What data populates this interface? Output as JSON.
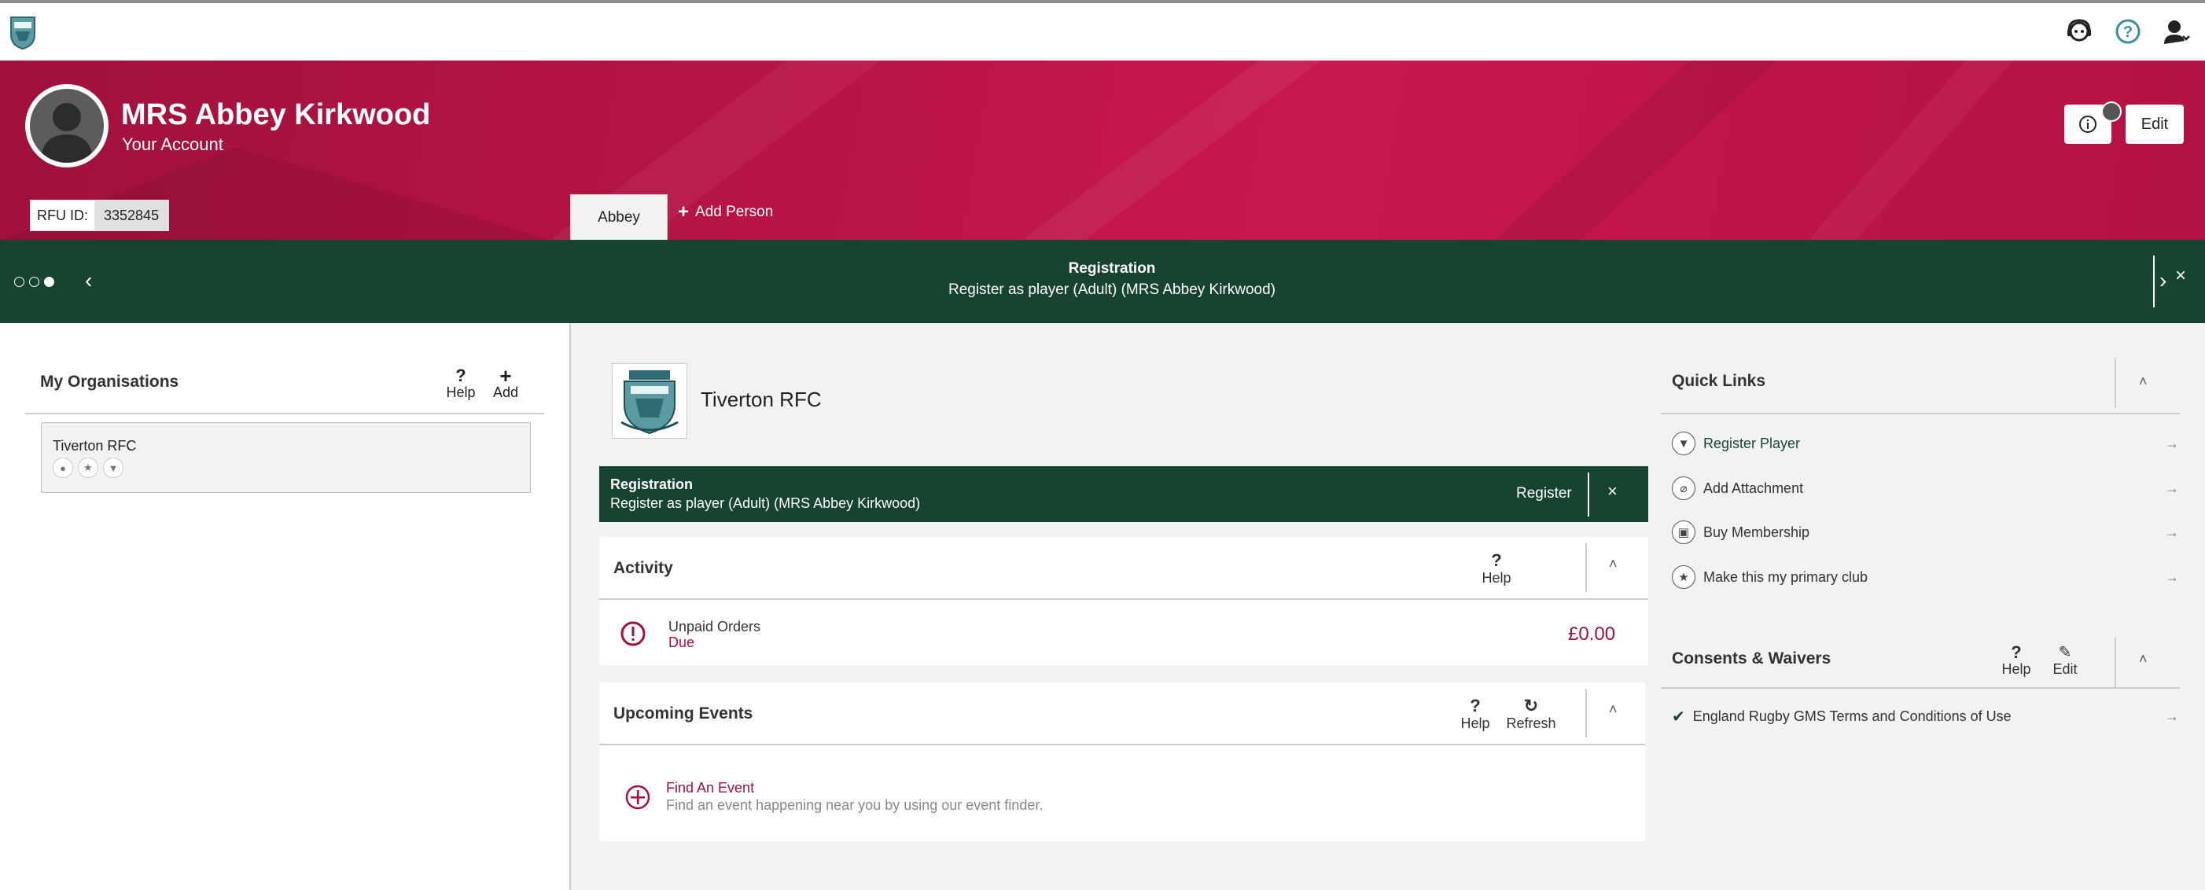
{
  "header": {
    "logo": "club-crest-logo",
    "icons": [
      "support-agent-icon",
      "help-circle-icon",
      "user-menu-icon"
    ]
  },
  "hero": {
    "name": "MRS Abbey Kirkwood",
    "subtitle": "Your Account",
    "rfu_label": "RFU ID:",
    "rfu_value": "3352845",
    "tab_label": "Abbey",
    "add_person": "Add Person",
    "edit_label": "Edit"
  },
  "banner": {
    "title": "Registration",
    "text": "Register as player (Adult) (MRS Abbey Kirkwood)",
    "slide_count": 3,
    "active_slide": 3
  },
  "organisations": {
    "title": "My Organisations",
    "help": "Help",
    "add": "Add",
    "items": [
      {
        "name": "Tiverton RFC"
      }
    ]
  },
  "club": {
    "name": "Tiverton RFC",
    "registration": {
      "title": "Registration",
      "text": "Register as player (Adult) (MRS Abbey Kirkwood)",
      "button": "Register"
    }
  },
  "activity": {
    "title": "Activity",
    "help": "Help",
    "item_title": "Unpaid Orders",
    "item_status": "Due",
    "item_amount": "£0.00"
  },
  "events": {
    "title": "Upcoming Events",
    "help": "Help",
    "refresh": "Refresh",
    "find_title": "Find An Event",
    "find_text": "Find an event happening near you by using our event finder."
  },
  "quick_links": {
    "title": "Quick Links",
    "items": [
      {
        "label": "Register Player",
        "icon": "shirt-icon"
      },
      {
        "label": "Add Attachment",
        "icon": "paperclip-icon"
      },
      {
        "label": "Buy Membership",
        "icon": "membership-card-icon"
      },
      {
        "label": "Make this my primary club",
        "icon": "star-icon"
      }
    ]
  },
  "consents": {
    "title": "Consents & Waivers",
    "help": "Help",
    "edit": "Edit",
    "items": [
      {
        "label": "England Rugby GMS Terms and Conditions of Use"
      }
    ]
  },
  "colors": {
    "brand_red": "#b81446",
    "brand_green": "#174430",
    "alert_red": "#a0113c"
  }
}
